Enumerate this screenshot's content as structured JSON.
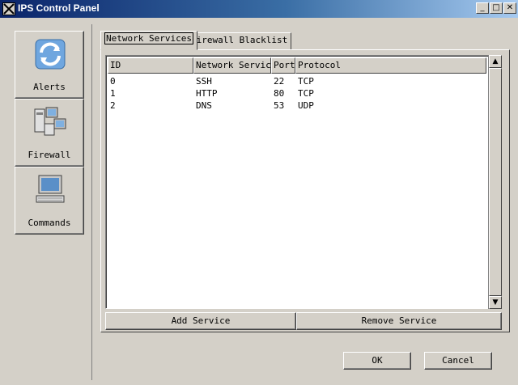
{
  "window": {
    "title": "IPS Control Panel",
    "minimize_glyph": "_",
    "maximize_glyph": "□",
    "close_glyph": "✕"
  },
  "sidebar": {
    "items": [
      {
        "label": "Alerts",
        "icon": "refresh-arrows-icon"
      },
      {
        "label": "Firewall",
        "icon": "network-computers-icon"
      },
      {
        "label": "Commands",
        "icon": "computer-terminal-icon"
      }
    ]
  },
  "tabs": [
    {
      "label": "Network Services",
      "active": true
    },
    {
      "label": "Firewall Blacklist",
      "active": false
    }
  ],
  "table": {
    "columns": [
      "ID",
      "Network Service",
      "Port",
      "Protocol"
    ],
    "rows": [
      [
        "0",
        "SSH",
        "22",
        "TCP"
      ],
      [
        "1",
        "HTTP",
        "80",
        "TCP"
      ],
      [
        "2",
        "DNS",
        "53",
        "UDP"
      ]
    ]
  },
  "scrollbar": {
    "up_glyph": "▲",
    "down_glyph": "▼"
  },
  "actions": {
    "add_service": "Add Service",
    "remove_service": "Remove Service"
  },
  "dialog": {
    "ok": "OK",
    "cancel": "Cancel"
  },
  "colors": {
    "titlebar_start": "#0a246a",
    "titlebar_end": "#a6caf0",
    "face": "#d4d0c8"
  }
}
